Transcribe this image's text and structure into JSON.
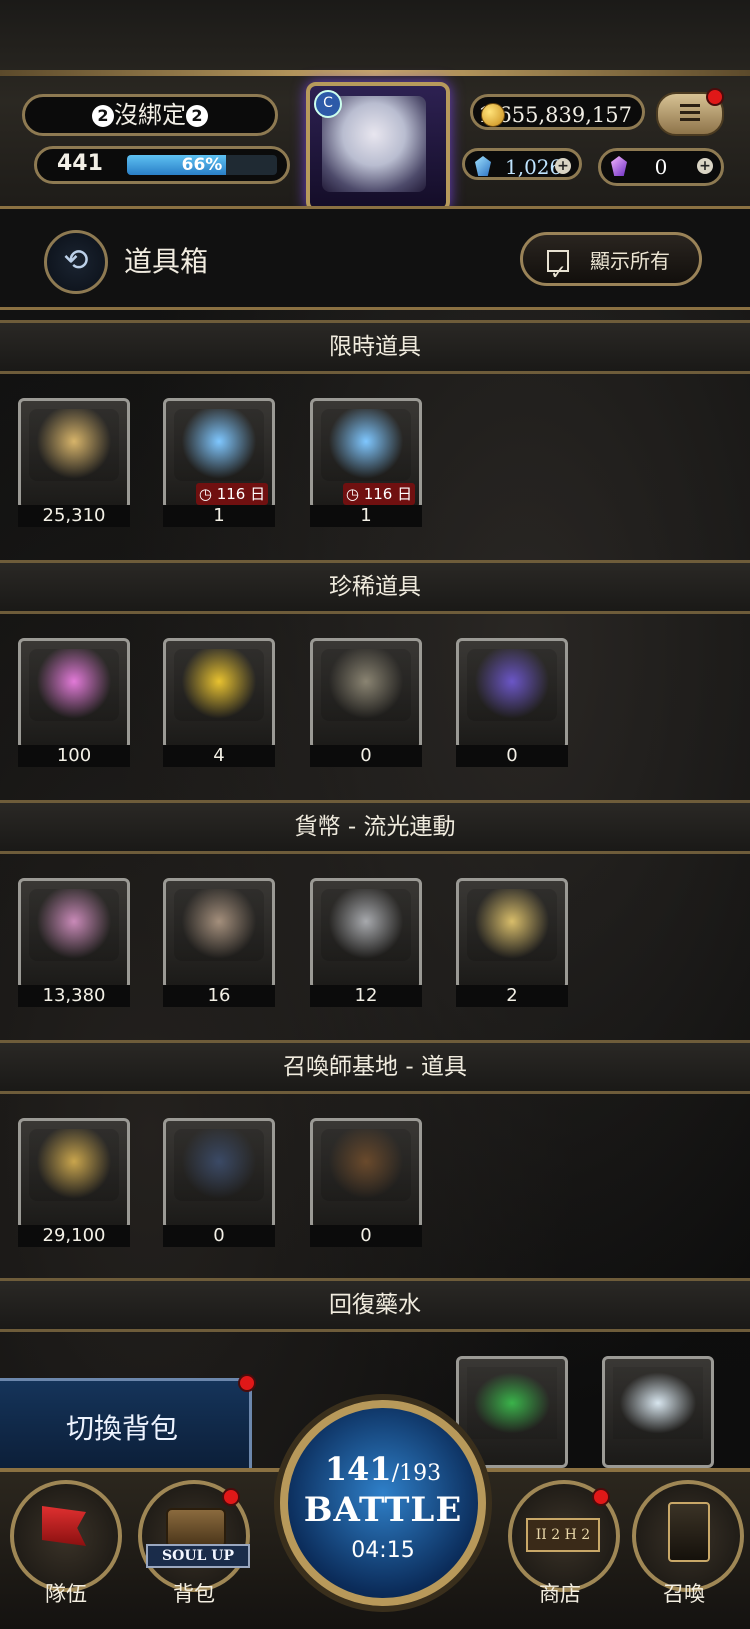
{
  "hud": {
    "player_name": "沒綁定",
    "name_badge": "2",
    "level": "441",
    "exp_percent": "66%",
    "exp_fraction": 0.66,
    "gold": "1,655,839,157",
    "diamonds": "1,026",
    "crystals": "0",
    "plus_glyph": "+",
    "avatar_badge": "C"
  },
  "title_bar": {
    "title": "道具箱",
    "show_all_label": "顯示所有",
    "back_glyph": "⟲"
  },
  "sections": [
    {
      "title": "限時道具",
      "items": [
        {
          "qty": "25,310",
          "icon": "gold-medal-icon",
          "color": "#d7b46a"
        },
        {
          "qty": "1",
          "icon": "summon-orb-lion-icon",
          "color": "#7fc7ff",
          "timer": "116 日"
        },
        {
          "qty": "1",
          "icon": "summon-orb-green-icon",
          "color": "#7fc7ff",
          "timer": "116 日"
        }
      ]
    },
    {
      "title": "珍稀道具",
      "items": [
        {
          "qty": "100",
          "icon": "pink-ticket-icon",
          "color": "#e27ad8"
        },
        {
          "qty": "4",
          "icon": "golden-heart-icon",
          "color": "#e8c230"
        },
        {
          "qty": "0",
          "icon": "horn-icon",
          "color": "#8a8472"
        },
        {
          "qty": "0",
          "icon": "purple-crystal-icon",
          "color": "#6b56c7"
        }
      ]
    },
    {
      "title": "貨幣 - 流光連動",
      "items": [
        {
          "qty": "13,380",
          "icon": "prism-gem-icon",
          "color": "#c98ab8"
        },
        {
          "qty": "16",
          "icon": "bronze-card-icon",
          "color": "#a48f7c"
        },
        {
          "qty": "12",
          "icon": "silver-card-icon",
          "color": "#a7a9ad"
        },
        {
          "qty": "2",
          "icon": "gold-card-icon",
          "color": "#d8bd6a"
        }
      ]
    },
    {
      "title": "召喚師基地 - 道具",
      "items": [
        {
          "qty": "29,100",
          "icon": "base-coin-icon",
          "color": "#c9a54d"
        },
        {
          "qty": "0",
          "icon": "blue-backpack-icon",
          "color": "#3b4a66"
        },
        {
          "qty": "0",
          "icon": "brown-backpack-icon",
          "color": "#6a4a2c"
        }
      ]
    },
    {
      "title": "回復藥水",
      "items": []
    }
  ],
  "potions": [
    {
      "icon": "green-bottle-icon",
      "color": "#3ab34a"
    },
    {
      "icon": "white-bottle-icon",
      "color": "#d8e6ef"
    }
  ],
  "nav": {
    "switch_bag": "切換背包",
    "team": "隊伍",
    "bag": "背包",
    "soul_up": "SOUL UP",
    "shop": "商店",
    "shop_sign": "II 2 H 2",
    "summon": "召喚",
    "battle_current": "141",
    "battle_max": "/193",
    "battle_label": "BATTLE",
    "battle_timer": "04:15"
  }
}
